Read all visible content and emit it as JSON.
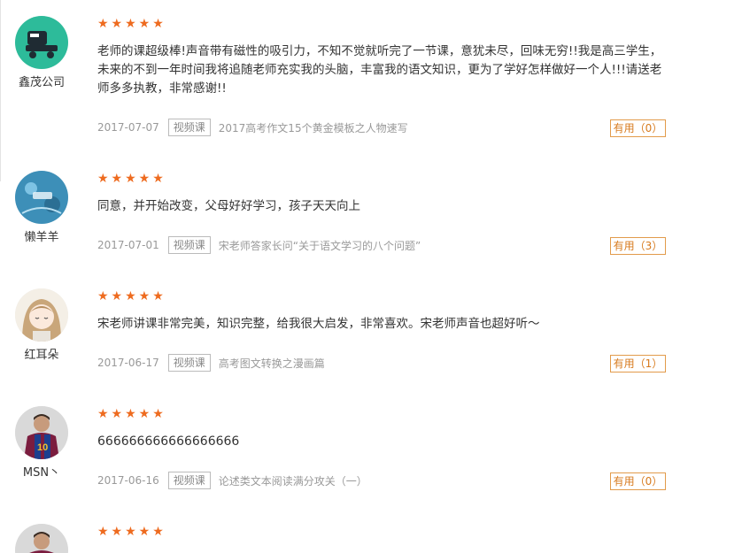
{
  "rating_stars": "★★★★★",
  "colors": {
    "star": "#ee6b1f",
    "useful_border": "#e29b4b",
    "useful_text": "#d77a1d"
  },
  "reviews": [
    {
      "user": "鑫茂公司",
      "avatar_icon": "roller-skate-avatar-icon",
      "content": "老师的课超级棒!声音带有磁性的吸引力，不知不觉就听完了一节课，意犹未尽，回味无穷!!我是高三学生，未来的不到一年时间我将追随老师充实我的头脑，丰富我的语文知识，更为了学好怎样做好一个人!!!请送老师多多执教，非常感谢!!",
      "date": "2017-07-07",
      "tag": "视频课",
      "course": "2017高考作文15个黄金模板之人物速写",
      "useful": "有用（0）"
    },
    {
      "user": "懒羊羊",
      "avatar_icon": "blue-doodle-avatar-icon",
      "content": "同意，并开始改变，父母好好学习，孩子天天向上",
      "date": "2017-07-01",
      "tag": "视频课",
      "course": "宋老师答家长问“关于语文学习的八个问题”",
      "useful": "有用（3）"
    },
    {
      "user": "红耳朵",
      "avatar_icon": "anime-girl-avatar-icon",
      "content": "宋老师讲课非常完美，知识完整，给我很大启发，非常喜欢。宋老师声音也超好听～",
      "date": "2017-06-17",
      "tag": "视频课",
      "course": "高考图文转换之漫画篇",
      "useful": "有用（1）"
    },
    {
      "user": "MSN丶",
      "avatar_icon": "soccer-player-avatar-icon",
      "content": "666666666666666666",
      "date": "2017-06-16",
      "tag": "视频课",
      "course": "论述类文本阅读满分攻关（一）",
      "useful": "有用（0）"
    }
  ]
}
